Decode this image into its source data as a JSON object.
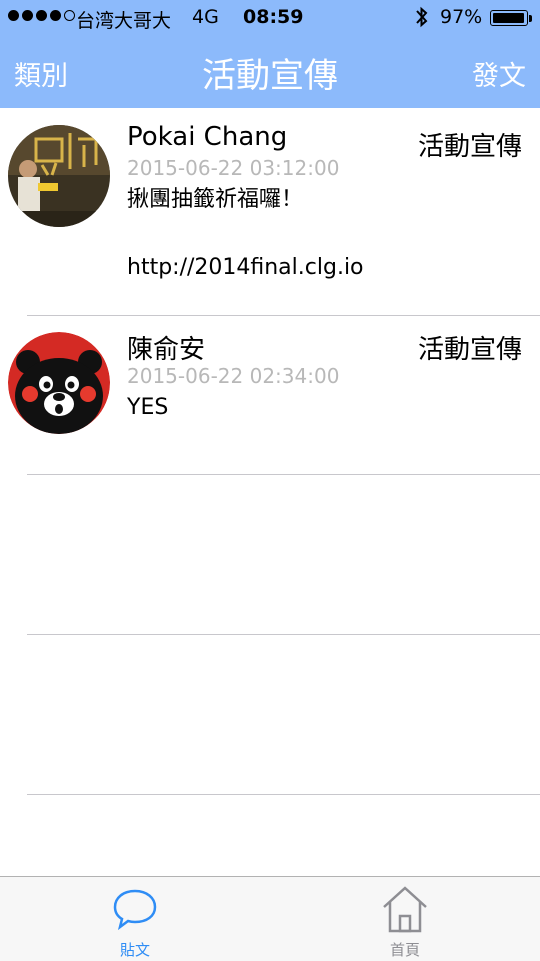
{
  "status_bar": {
    "carrier": "台湾大哥大",
    "network": "4G",
    "time": "08:59",
    "battery": "97%",
    "battery_level": 0.97,
    "signal_bars": 4
  },
  "nav": {
    "left": "類別",
    "title": "活動宣傳",
    "right": "發文"
  },
  "posts": [
    {
      "author": "Pokai Chang",
      "category": "活動宣傳",
      "time": "2015-06-22 03:12:00",
      "content": "揪團抽籤祈福囉！\n\nhttp://2014final.clg.io"
    },
    {
      "author": "陳俞安",
      "category": "活動宣傳",
      "time": "2015-06-22 02:34:00",
      "content": "YES"
    }
  ],
  "tabs": [
    {
      "label": "貼文",
      "icon": "speech-bubble-icon",
      "color": "#2f8df5"
    },
    {
      "label": "首頁",
      "icon": "house-icon",
      "color": "#8e8e93"
    }
  ],
  "colors": {
    "nav_bar": "#8cbafb",
    "timestamp": "#b8b8b8",
    "tab_active": "#2f8df5",
    "tab_inactive": "#8e8e93"
  }
}
